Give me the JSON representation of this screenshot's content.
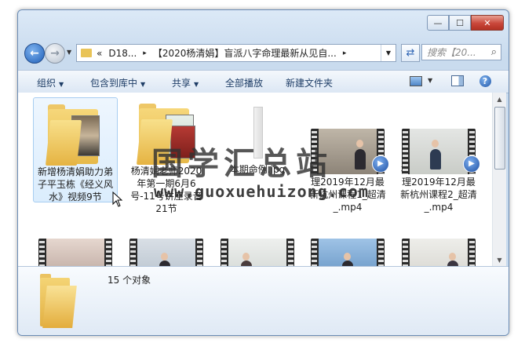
{
  "window": {
    "controls": {
      "minimize": "—",
      "maximize": "☐",
      "close": "✕"
    }
  },
  "nav": {
    "back_icon": "back-arrow-icon",
    "forward_icon": "forward-arrow-icon",
    "address": {
      "chevron": "«",
      "segments": [
        "D18...",
        "【2020杨清娟】盲派八字命理最新从见自..."
      ],
      "separator": "▸"
    },
    "search_placeholder": "搜索【20..."
  },
  "toolbar": {
    "organize": "组织",
    "include_in_library": "包含到库中",
    "share": "共享",
    "play_all": "全部播放",
    "new_folder": "新建文件夹"
  },
  "files": [
    {
      "name": "新增杨清娟助力弟子平玉栋《经义风水》视频9节",
      "type": "folder"
    },
    {
      "name": "杨清娟老师2020年第一期6月6号-11号讲座录音21节",
      "type": "folder"
    },
    {
      "name": "本期命例.jpg",
      "type": "image"
    },
    {
      "name": "杨清娟盲派八字命理2019年12月最新杭州课程1_超清_.mp4",
      "type": "video"
    },
    {
      "name": "杨清娟盲派八字命理2019年12月最新杭州课程2_超清_.mp4",
      "type": "video"
    },
    {
      "name": "",
      "type": "video"
    },
    {
      "name": "",
      "type": "video"
    },
    {
      "name": "",
      "type": "video"
    },
    {
      "name": "",
      "type": "video"
    },
    {
      "name": "",
      "type": "video"
    }
  ],
  "status": {
    "count": "15 个对象"
  },
  "watermark": {
    "text": "国学汇总站",
    "url": "www.guoxuehuizong.com"
  }
}
